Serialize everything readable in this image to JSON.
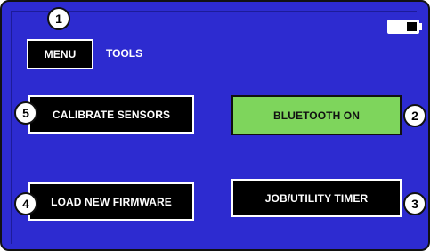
{
  "header": {
    "menu_label": "MENU",
    "screen_title": "TOOLS",
    "battery_icon": "battery-icon"
  },
  "buttons": {
    "calibrate": "CALIBRATE SENSORS",
    "bluetooth": "BLUETOOTH ON",
    "firmware": "LOAD NEW FIRMWARE",
    "timer": "JOB/UTILITY TIMER"
  },
  "callouts": [
    "1",
    "2",
    "3",
    "4",
    "5"
  ],
  "colors": {
    "background": "#2d2bd0",
    "bluetooth_active": "#7ed55c",
    "button": "#000000",
    "text": "#ffffff"
  }
}
